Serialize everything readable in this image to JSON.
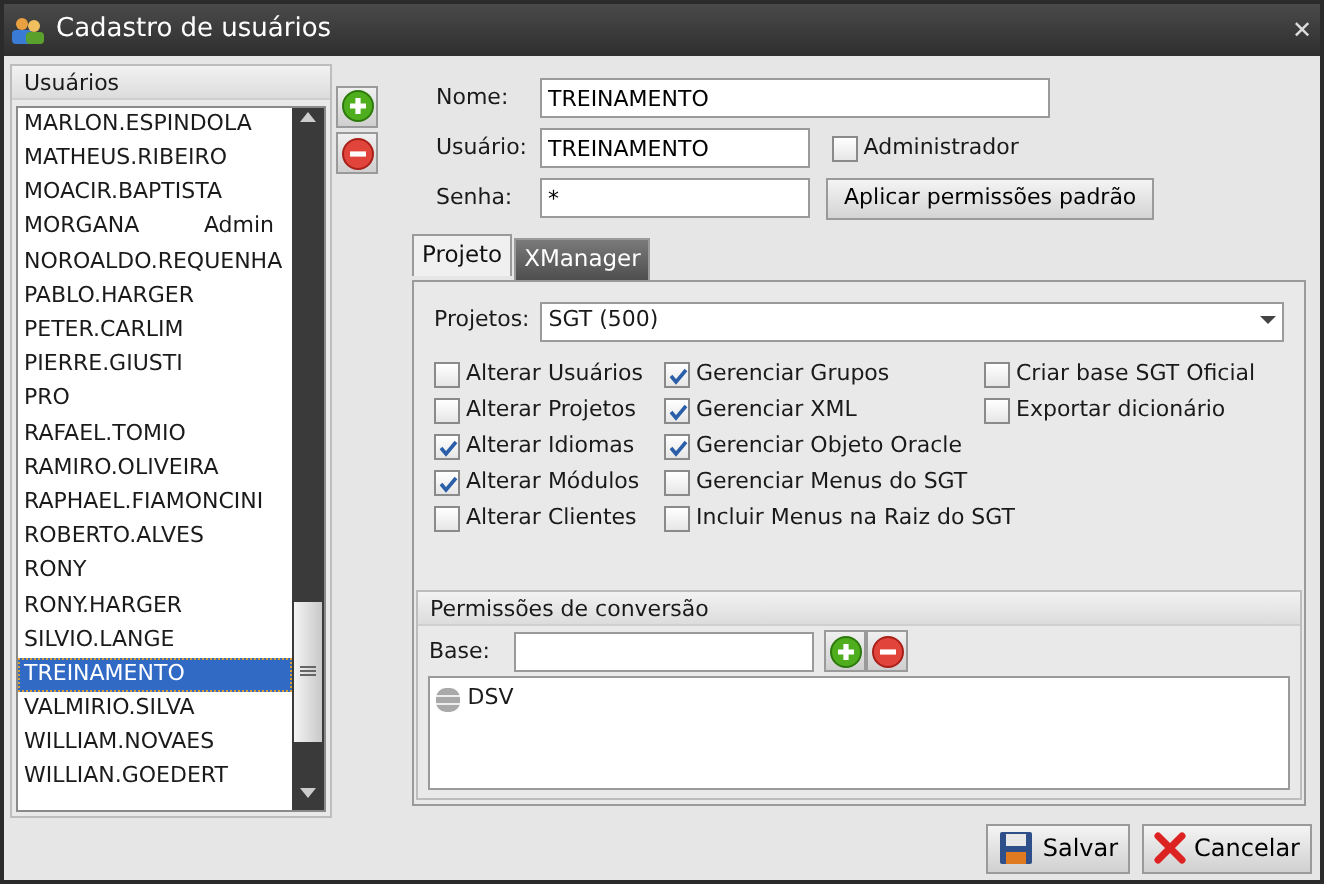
{
  "window": {
    "title": "Cadastro de usuários",
    "close": "✕"
  },
  "users": {
    "header": "Usuários",
    "items": [
      {
        "name": "MARLON.ESPINDOLA",
        "selected": false
      },
      {
        "name": "MATHEUS.RIBEIRO",
        "selected": false
      },
      {
        "name": "MOACIR.BAPTISTA",
        "selected": false
      },
      {
        "name": "MORGANA",
        "role": "Admin",
        "selected": false
      },
      {
        "name": "NOROALDO.REQUENHA",
        "selected": false
      },
      {
        "name": "PABLO.HARGER",
        "selected": false
      },
      {
        "name": "PETER.CARLIM",
        "selected": false
      },
      {
        "name": "PIERRE.GIUSTI",
        "selected": false
      },
      {
        "name": "PRO",
        "selected": false
      },
      {
        "name": "RAFAEL.TOMIO",
        "selected": false
      },
      {
        "name": "RAMIRO.OLIVEIRA",
        "selected": false
      },
      {
        "name": "RAPHAEL.FIAMONCINI",
        "selected": false
      },
      {
        "name": "ROBERTO.ALVES",
        "selected": false
      },
      {
        "name": "RONY",
        "selected": false
      },
      {
        "name": "RONY.HARGER",
        "selected": false
      },
      {
        "name": "SILVIO.LANGE",
        "selected": false
      },
      {
        "name": "TREINAMENTO",
        "selected": true
      },
      {
        "name": "VALMIRIO.SILVA",
        "selected": false
      },
      {
        "name": "WILLIAM.NOVAES",
        "selected": false
      },
      {
        "name": "WILLIAN.GOEDERT",
        "selected": false
      }
    ]
  },
  "form": {
    "nome_label": "Nome:",
    "nome": "TREINAMENTO",
    "usuario_label": "Usuário:",
    "usuario": "TREINAMENTO",
    "admin_label": "Administrador",
    "admin_checked": false,
    "senha_label": "Senha:",
    "senha": "*",
    "apply_button": "Aplicar permissões padrão"
  },
  "tabs": [
    {
      "label": "Projeto",
      "selected": true
    },
    {
      "label": "XManager",
      "selected": false
    }
  ],
  "projeto": {
    "projetos_label": "Projetos:",
    "projetos": "SGT (500)",
    "permission_columns": [
      [
        {
          "label": "Alterar Usuários",
          "checked": false
        },
        {
          "label": "Alterar Projetos",
          "checked": false
        },
        {
          "label": "Alterar Idiomas",
          "checked": true
        },
        {
          "label": "Alterar Módulos",
          "checked": true
        },
        {
          "label": "Alterar Clientes",
          "checked": false
        }
      ],
      [
        {
          "label": "Gerenciar Grupos",
          "checked": true
        },
        {
          "label": "Gerenciar XML",
          "checked": true
        },
        {
          "label": "Gerenciar Objeto Oracle",
          "checked": true
        },
        {
          "label": "Gerenciar Menus do SGT",
          "checked": false
        },
        {
          "label": "Incluir Menus na Raiz do SGT",
          "checked": false
        }
      ],
      [
        {
          "label": "Criar base SGT Oficial",
          "checked": false
        },
        {
          "label": "Exportar dicionário",
          "checked": false
        }
      ]
    ]
  },
  "conversao": {
    "header": "Permissões de conversão",
    "base_label": "Base:",
    "bases": [
      "DSV"
    ]
  },
  "buttons": [
    {
      "kind": "save",
      "label": "Salvar"
    },
    {
      "kind": "cancel",
      "label": "Cancelar"
    }
  ]
}
